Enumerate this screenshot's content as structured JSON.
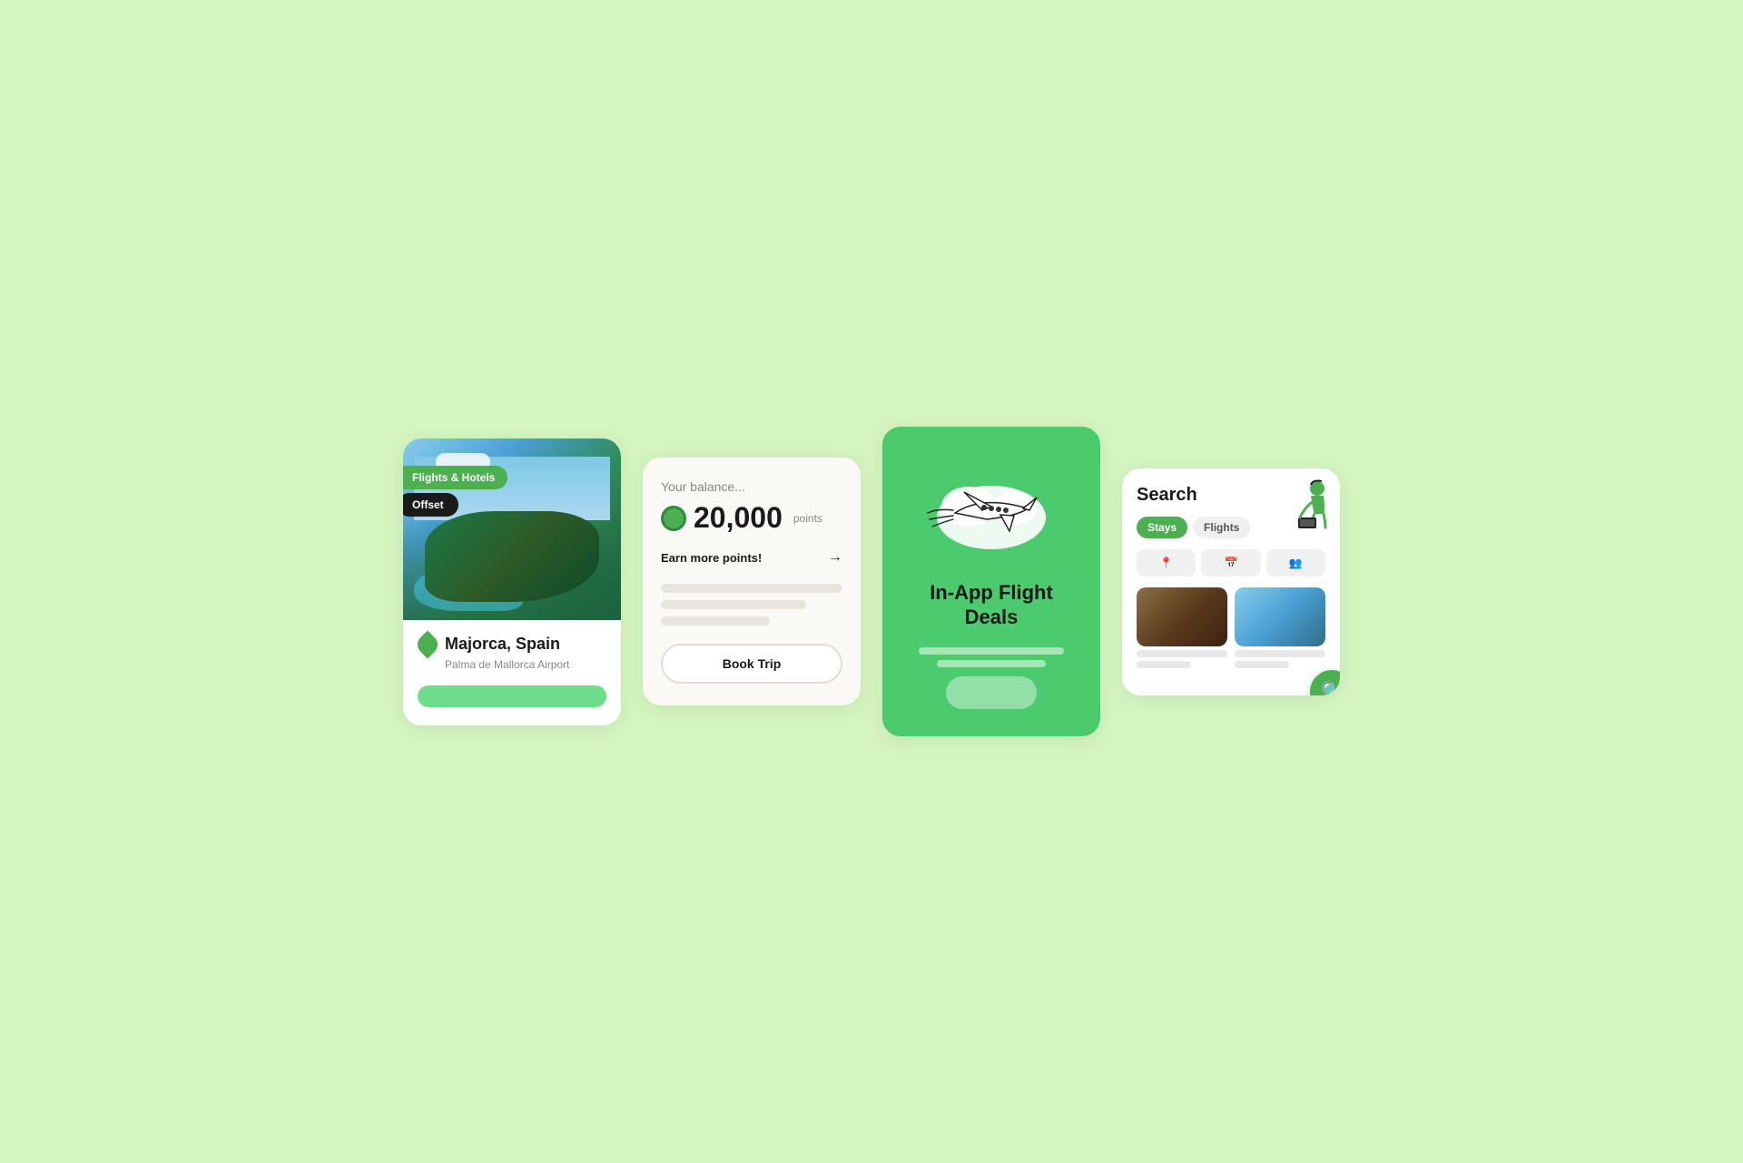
{
  "background_color": "#d4f5c0",
  "card1": {
    "badge_flights": "Flights & Hotels",
    "badge_offset": "Offset",
    "city": "Majorca, Spain",
    "airport": "Palma de Mallorca Airport",
    "button_label": ""
  },
  "card2": {
    "balance_label": "Your balance...",
    "balance_amount": "20,000",
    "balance_points_label": "points",
    "earn_text": "Earn more points!",
    "book_button": "Book Trip"
  },
  "card3": {
    "title": "In-App Flight Deals"
  },
  "card4": {
    "title": "Search",
    "tab_stays": "Stays",
    "tab_flights": "Flights",
    "tab_stays_active": true
  }
}
